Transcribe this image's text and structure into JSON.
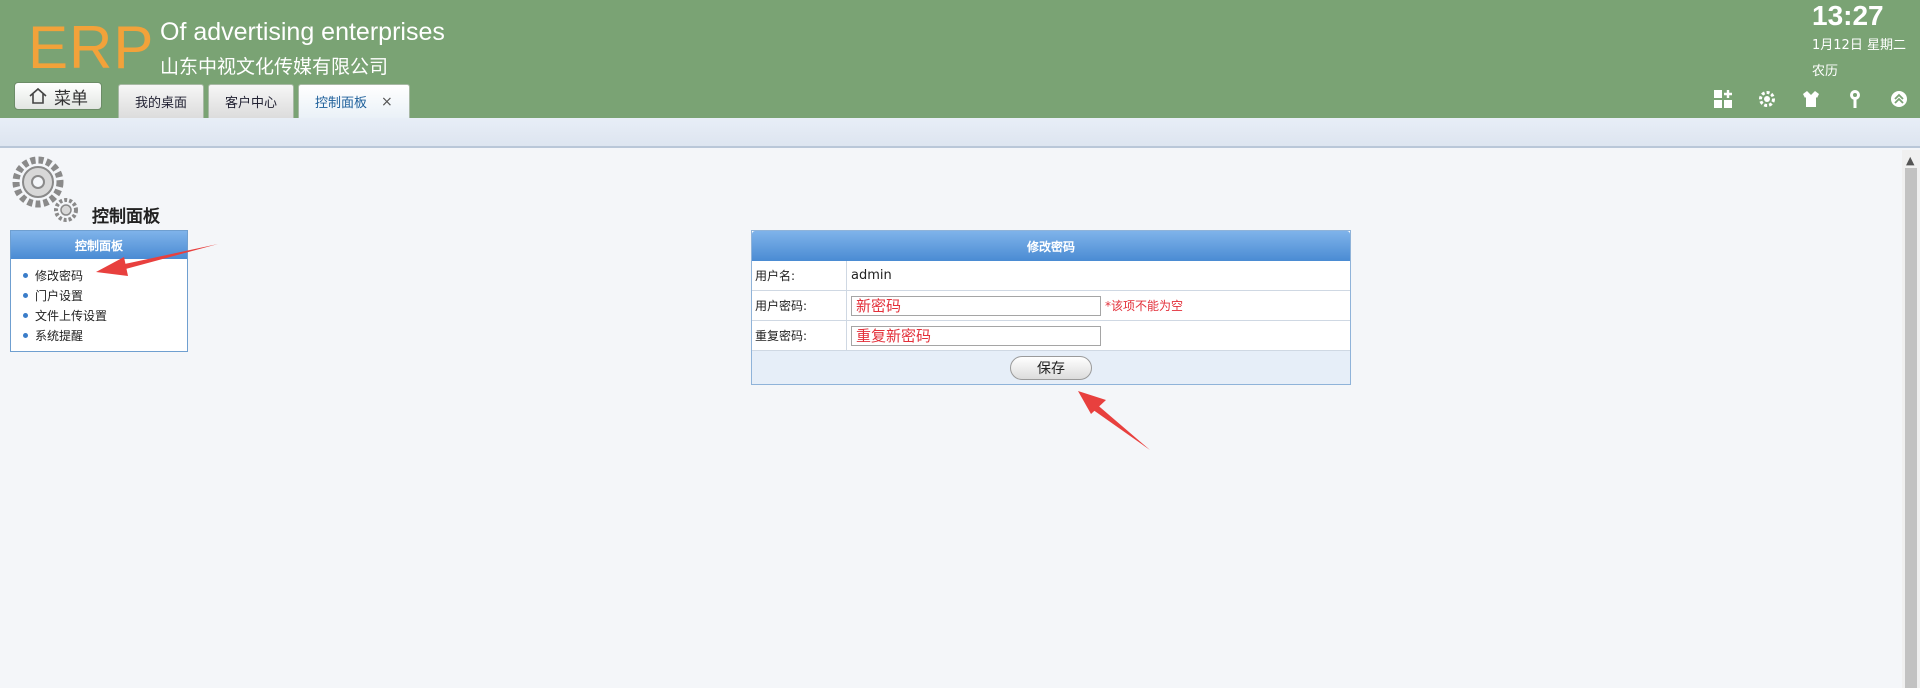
{
  "header": {
    "logo": "ERP",
    "company_en": "Of advertising enterprises",
    "company_cn": "山东中视文化传媒有限公司",
    "time": "13:27",
    "date": "1月12日 星期二",
    "lunar": "农历",
    "menu_label": "菜单",
    "icons": [
      "grid-add-icon",
      "gear-icon",
      "shirt-icon",
      "key-icon",
      "collapse-icon"
    ]
  },
  "tabs": [
    {
      "label": "我的桌面",
      "active": false
    },
    {
      "label": "客户中心",
      "active": false
    },
    {
      "label": "控制面板",
      "active": true,
      "close": "×"
    }
  ],
  "sidebar": {
    "page_title": "控制面板",
    "panel_title": "控制面板",
    "items": [
      {
        "label": "修改密码"
      },
      {
        "label": "门户设置"
      },
      {
        "label": "文件上传设置"
      },
      {
        "label": "系统提醒"
      }
    ]
  },
  "form": {
    "title": "修改密码",
    "username_label": "用户名:",
    "username_value": "admin",
    "password_label": "用户密码:",
    "password_placeholder": "新密码",
    "password_error": "*该项不能为空",
    "repeat_label": "重复密码:",
    "repeat_placeholder": "重复新密码",
    "save_label": "保存"
  },
  "colors": {
    "header_bg": "#7aa374",
    "logo": "#f2a23a",
    "panel_head": "#4a8bd3",
    "error": "#e3303a",
    "arrow": "#e8403e"
  }
}
